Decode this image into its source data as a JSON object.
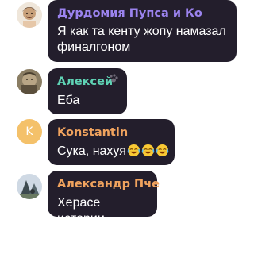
{
  "messages": [
    {
      "sender": "Дурдомия Пупса и Ко",
      "text": "Я как та кенту жопу намазал финалгоном",
      "avatar": "photo-avatar",
      "sender_color": "#9b83ee"
    },
    {
      "sender": "Алексей",
      "text": "Еба",
      "avatar": "photo-avatar",
      "sender_color": "#5fd3b5"
    },
    {
      "sender": "Konstantin",
      "text": "Сука, нахуя",
      "emoji": [
        "joy-emoji",
        "joy-emoji",
        "joy-emoji"
      ],
      "avatar": "initial-avatar",
      "avatar_initial": "K",
      "avatar_color": "#f4c16a",
      "sender_color": "#f0a35e"
    },
    {
      "sender": "Александр Пче",
      "text": "Херасе истории",
      "avatar": "photo-avatar",
      "sender_color": "#f0a35e"
    }
  ]
}
